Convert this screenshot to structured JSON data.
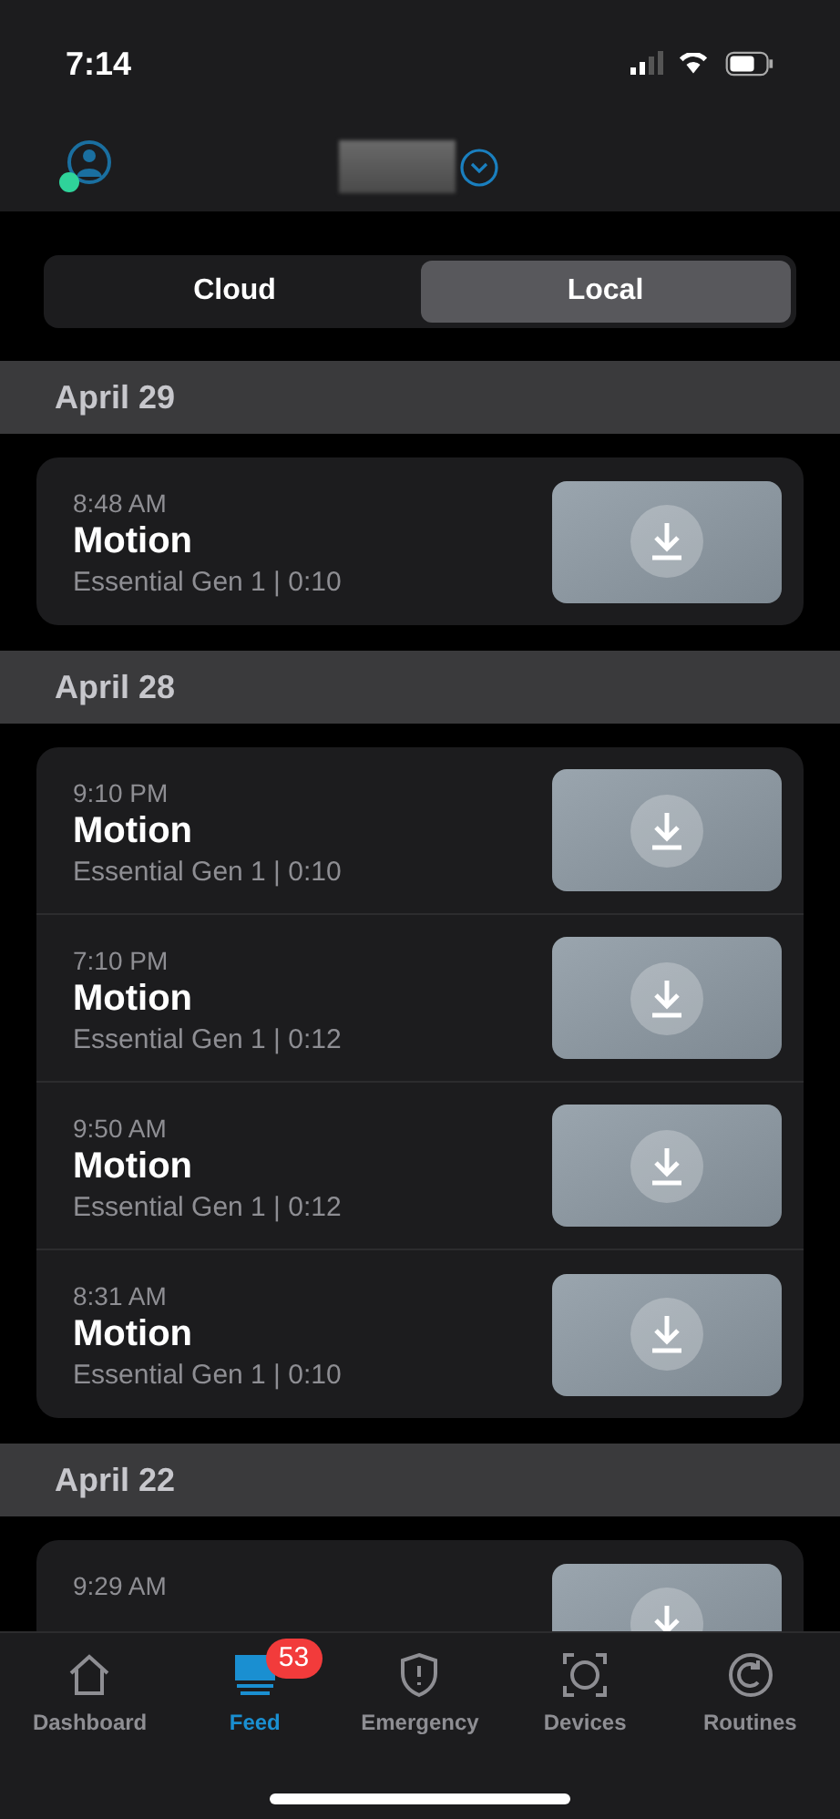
{
  "status_bar": {
    "time": "7:14"
  },
  "segments": [
    {
      "label": "Cloud",
      "selected": false
    },
    {
      "label": "Local",
      "selected": true
    }
  ],
  "sections": [
    {
      "date": "April 29",
      "events": [
        {
          "time": "8:48 AM",
          "title": "Motion",
          "detail": "Essential Gen 1 | 0:10"
        }
      ]
    },
    {
      "date": "April 28",
      "events": [
        {
          "time": "9:10 PM",
          "title": "Motion",
          "detail": "Essential Gen 1 | 0:10"
        },
        {
          "time": "7:10 PM",
          "title": "Motion",
          "detail": "Essential Gen 1 | 0:12"
        },
        {
          "time": "9:50 AM",
          "title": "Motion",
          "detail": "Essential Gen 1 | 0:12"
        },
        {
          "time": "8:31 AM",
          "title": "Motion",
          "detail": "Essential Gen 1 | 0:10"
        }
      ]
    },
    {
      "date": "April 22",
      "events": [
        {
          "time": "9:29 AM"
        }
      ]
    }
  ],
  "tab_bar": [
    {
      "label": "Dashboard",
      "kind": "home",
      "selected": false
    },
    {
      "label": "Feed",
      "kind": "feed",
      "selected": true,
      "badge": "53"
    },
    {
      "label": "Emergency",
      "kind": "shield",
      "selected": false
    },
    {
      "label": "Devices",
      "kind": "camera",
      "selected": false
    },
    {
      "label": "Routines",
      "kind": "routine",
      "selected": false
    }
  ]
}
